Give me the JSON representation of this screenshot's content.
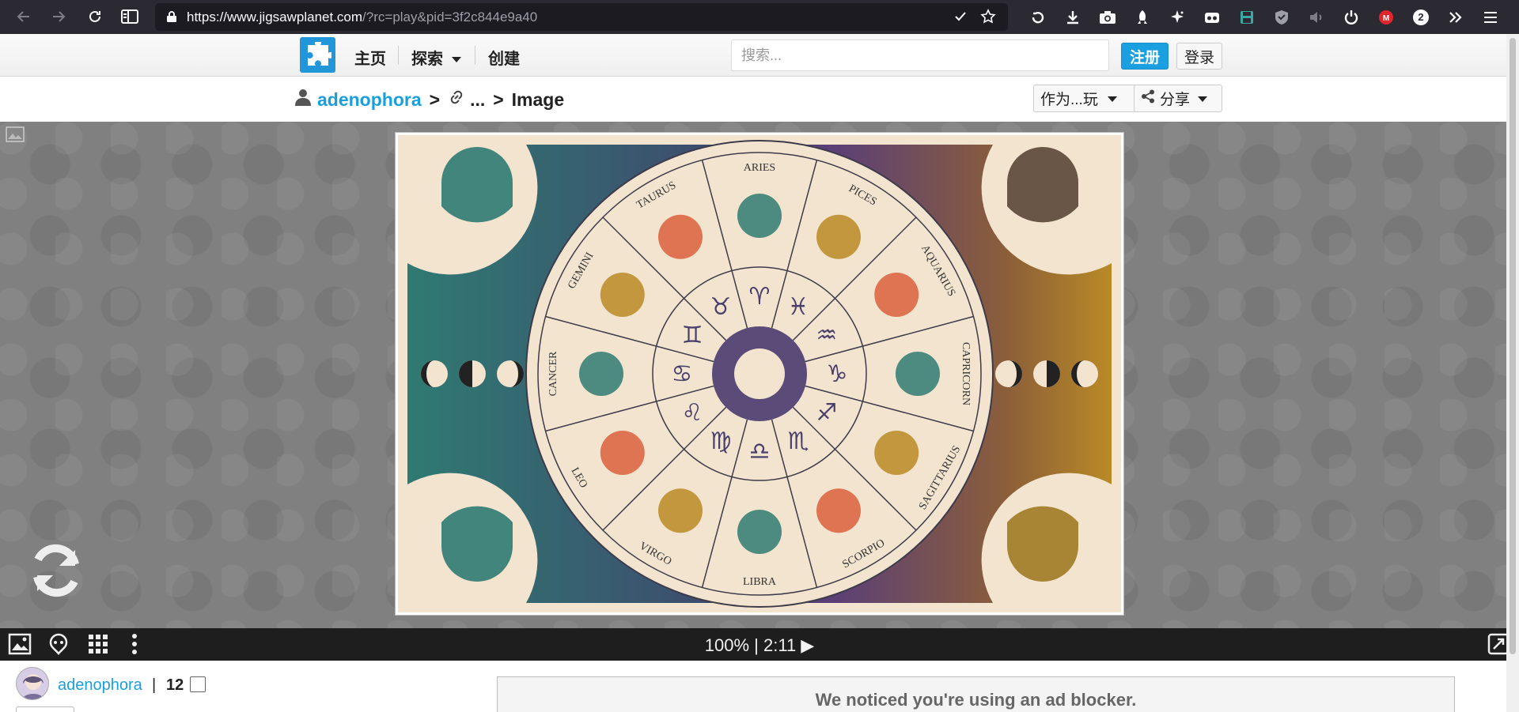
{
  "browser": {
    "url_host": "https://www.jigsawplanet.com",
    "url_path": "/?rc=play&pid=3f2c844e9a40",
    "notification_count": "2"
  },
  "header": {
    "nav": [
      "主页",
      "探索",
      "创建"
    ],
    "search_placeholder": "搜索...",
    "register_label": "注册",
    "login_label": "登录"
  },
  "breadcrumb": {
    "user": "adenophora",
    "sep": ">",
    "ellipsis": "...",
    "current": "Image",
    "play_as": "作为...玩",
    "share": "分享"
  },
  "puzzle": {
    "zodiac_labels": [
      "ARIES",
      "PICES",
      "AQUARIUS",
      "CAPRICORN",
      "SAGITTARIUS",
      "SCORPIO",
      "LIBRA",
      "VIRGO",
      "LEO",
      "CANCER",
      "GEMINI",
      "TAURUS"
    ],
    "glyphs": [
      "♈",
      "♓",
      "♒",
      "♑",
      "♐",
      "♏",
      "♎",
      "♍",
      "♌",
      "♋",
      "♊",
      "♉"
    ],
    "colors": {
      "teal": "#2f7a72",
      "purple": "#5a3f78",
      "gold": "#b98a25",
      "cream": "#f3e4cf"
    }
  },
  "controls": {
    "status": "100%  |  2:11 ▶"
  },
  "footer": {
    "username": "adenophora",
    "separator": "|",
    "count": "12",
    "adblock_message": "We noticed you're using an ad blocker."
  }
}
